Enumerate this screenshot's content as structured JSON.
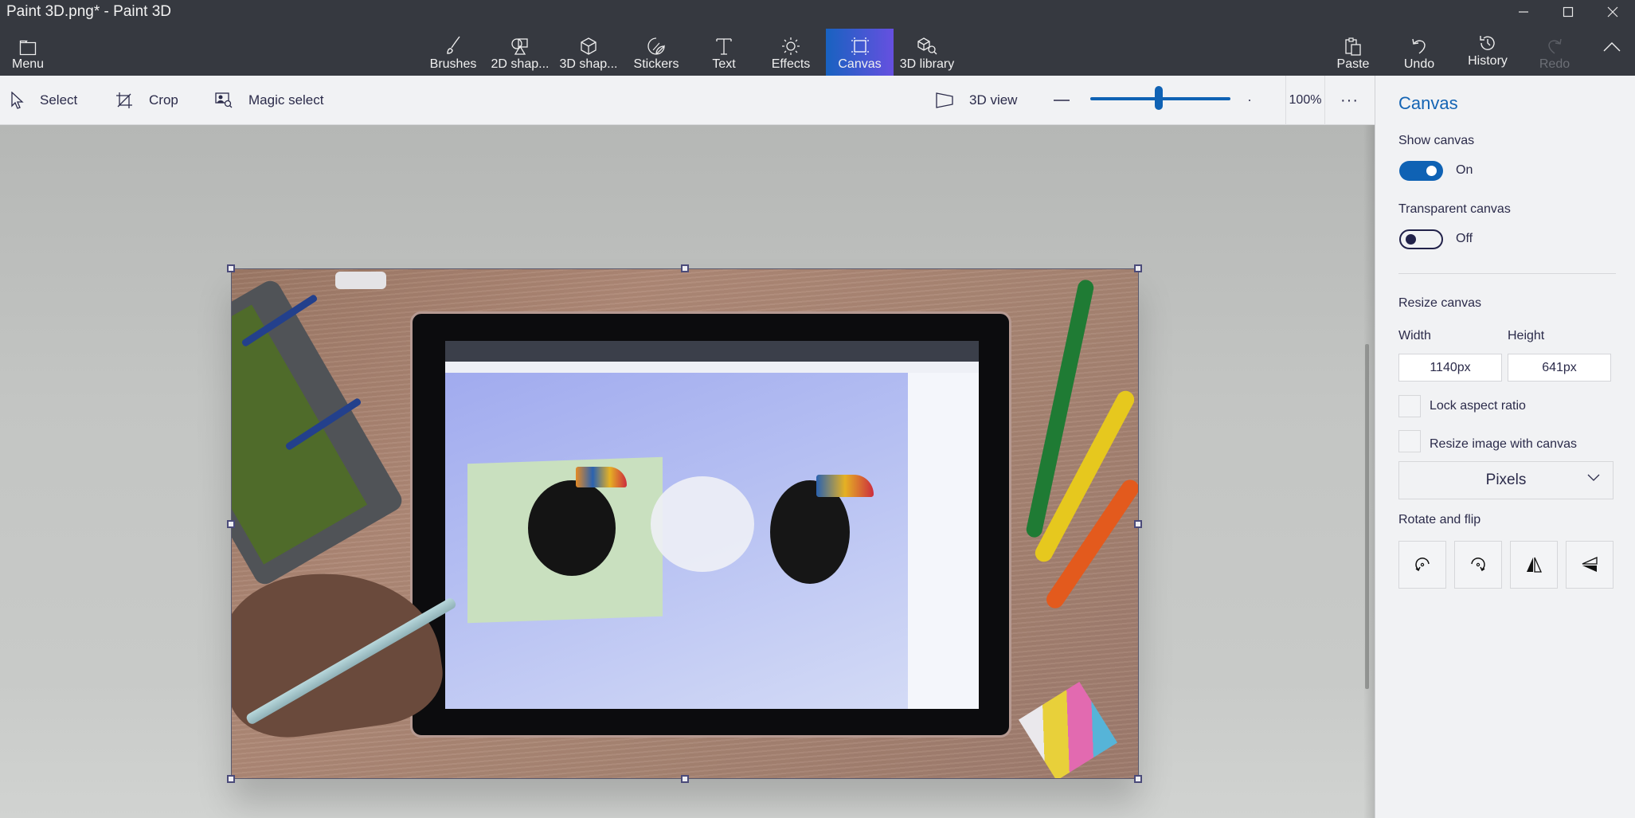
{
  "window": {
    "title": "Paint 3D.png* - Paint 3D",
    "controls": {
      "minimize": "—",
      "maximize": "☐",
      "close": "✕"
    }
  },
  "ribbon": {
    "menu": {
      "label": "Menu",
      "icon": "folder-icon"
    },
    "tools": [
      {
        "label": "Brushes",
        "icon": "brush-icon"
      },
      {
        "label": "2D shap...",
        "icon": "2d-shapes-icon"
      },
      {
        "label": "3D shap...",
        "icon": "3d-cube-icon"
      },
      {
        "label": "Stickers",
        "icon": "sticker-icon"
      },
      {
        "label": "Text",
        "icon": "text-icon"
      },
      {
        "label": "Effects",
        "icon": "sun-icon"
      },
      {
        "label": "Canvas",
        "icon": "canvas-icon",
        "active": true
      },
      {
        "label": "3D library",
        "icon": "3d-library-icon"
      }
    ],
    "actions": [
      {
        "label": "Paste",
        "icon": "paste-icon"
      },
      {
        "label": "Undo",
        "icon": "undo-icon"
      },
      {
        "label": "History",
        "icon": "history-icon"
      },
      {
        "label": "Redo",
        "icon": "redo-icon",
        "disabled": true
      }
    ],
    "collapse_icon": "chevron-up-icon",
    "active_color": "#1862c0"
  },
  "toolbar": {
    "select": "Select",
    "crop": "Crop",
    "magic_select": "Magic select",
    "view_3d": "3D view",
    "zoom_out": "−",
    "zoom_in": "+",
    "zoom_value": "100%",
    "zoom_slider_fraction": 0.5,
    "more": "···"
  },
  "canvas": {
    "image_description": "Photo of a Surface tablet on a wooden desk showing Paint 3D with toucan illustrations, a hand holding a stylus, foosball toy on left, colored markers on right"
  },
  "panel": {
    "title": "Canvas",
    "show_canvas": {
      "label": "Show canvas",
      "state": "On",
      "value": true
    },
    "transparent_canvas": {
      "label": "Transparent canvas",
      "state": "Off",
      "value": false
    },
    "resize_canvas": "Resize canvas",
    "width_label": "Width",
    "height_label": "Height",
    "width_value": "1140px",
    "height_value": "641px",
    "lock_aspect": {
      "label": "Lock aspect ratio",
      "checked": false
    },
    "resize_image": {
      "label": "Resize image with canvas",
      "checked": false
    },
    "units": "Pixels",
    "rotate_flip": "Rotate and flip",
    "rotate_buttons": [
      {
        "name": "rotate-left",
        "icon": "rotate-left-icon"
      },
      {
        "name": "rotate-right",
        "icon": "rotate-right-icon"
      },
      {
        "name": "flip-horizontal",
        "icon": "flip-horizontal-icon"
      },
      {
        "name": "flip-vertical",
        "icon": "flip-vertical-icon"
      }
    ],
    "accent_color": "#0f62b4"
  }
}
